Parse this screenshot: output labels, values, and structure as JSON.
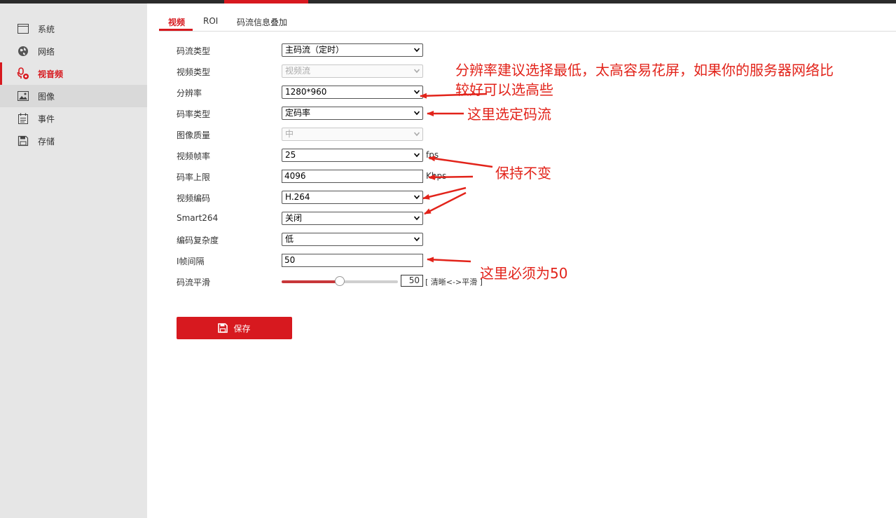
{
  "colors": {
    "accent": "#d7191f",
    "annotation": "#e2231a"
  },
  "sidebar": {
    "items": [
      {
        "label": "系统",
        "icon": "window-icon"
      },
      {
        "label": "网络",
        "icon": "globe-icon"
      },
      {
        "label": "视音频",
        "icon": "mic-settings-icon"
      },
      {
        "label": "图像",
        "icon": "image-icon"
      },
      {
        "label": "事件",
        "icon": "calendar-icon"
      },
      {
        "label": "存储",
        "icon": "floppy-icon"
      }
    ]
  },
  "tabs": [
    {
      "label": "视频"
    },
    {
      "label": "ROI"
    },
    {
      "label": "码流信息叠加"
    }
  ],
  "form": {
    "stream_type": {
      "label": "码流类型",
      "value": "主码流（定时）"
    },
    "video_type": {
      "label": "视频类型",
      "value": "视频流"
    },
    "resolution": {
      "label": "分辨率",
      "value": "1280*960"
    },
    "bitrate_type": {
      "label": "码率类型",
      "value": "定码率"
    },
    "image_quality": {
      "label": "图像质量",
      "value": "中"
    },
    "frame_rate": {
      "label": "视频帧率",
      "value": "25",
      "unit": "fps"
    },
    "max_bitrate": {
      "label": "码率上限",
      "value": "4096",
      "unit": "Kbps"
    },
    "video_encoding": {
      "label": "视频编码",
      "value": "H.264"
    },
    "smart264": {
      "label": "Smart264",
      "value": "关闭"
    },
    "complexity": {
      "label": "编码复杂度",
      "value": "低"
    },
    "i_frame_interval": {
      "label": "I帧间隔",
      "value": "50"
    },
    "smoothing": {
      "label": "码流平滑",
      "value": "50",
      "hint": "[ 清晰<->平滑 ]",
      "level": 0.5
    }
  },
  "save_button": {
    "label": "保存",
    "icon": "floppy-icon"
  },
  "annotations": {
    "resolution_note_line1": "分辨率建议选择最低，太高容易花屏，如果你的服务器网络比",
    "resolution_note_line2": "较好可以选高些",
    "bitrate_note": "这里选定码流",
    "keep_note": "保持不变",
    "iframe_note": "这里必须为50"
  }
}
